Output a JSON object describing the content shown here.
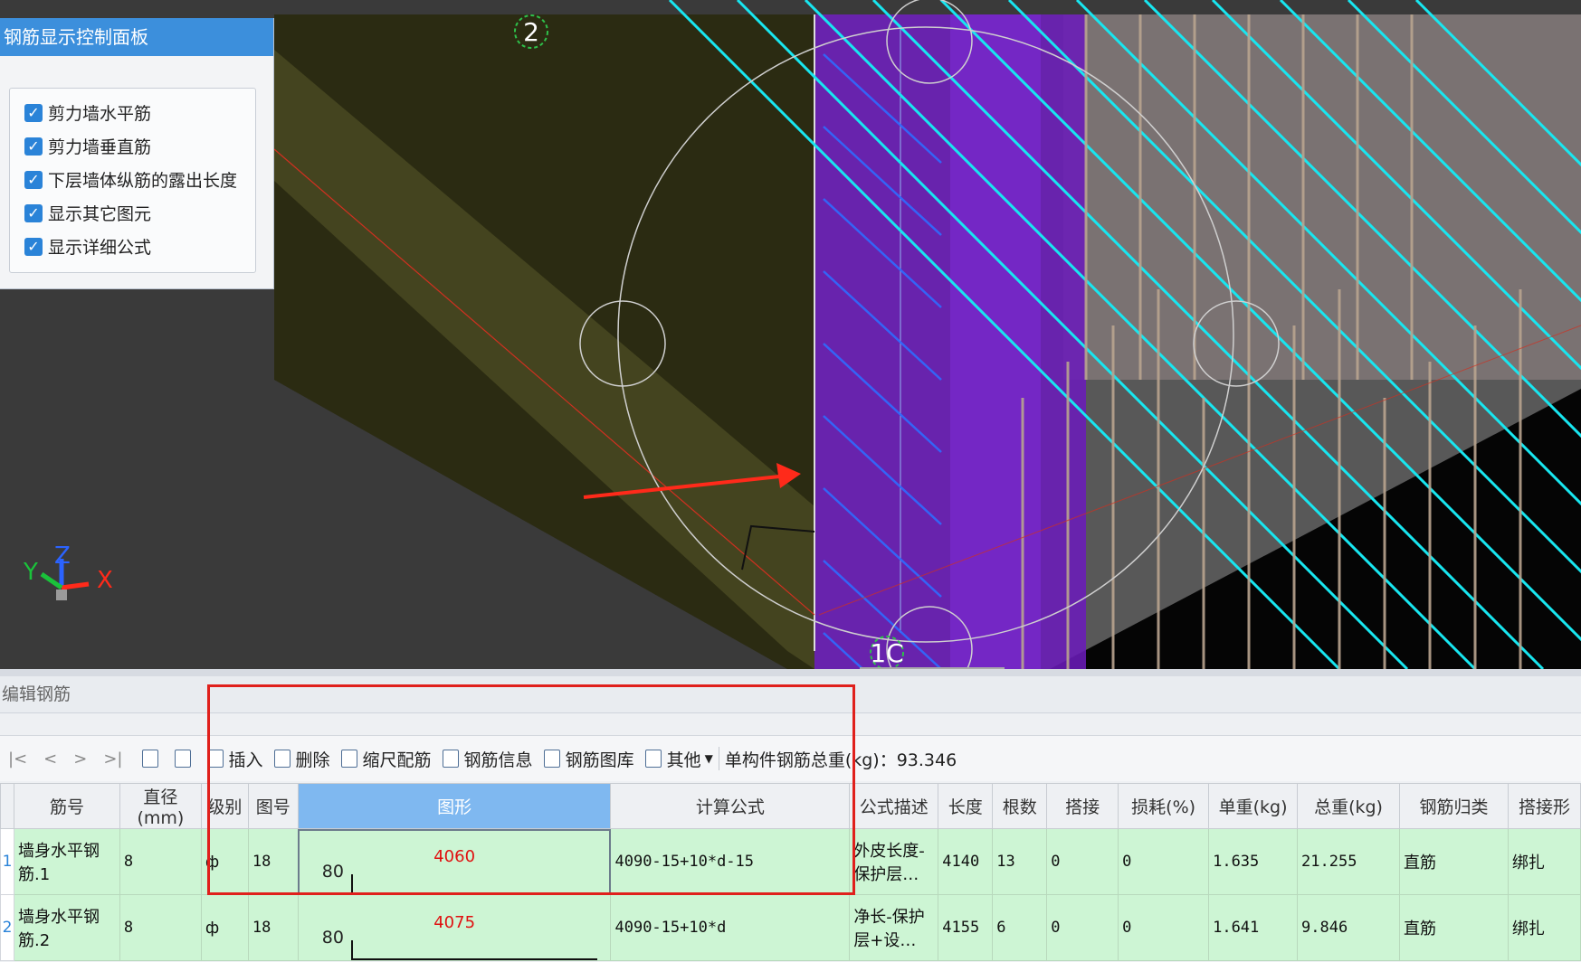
{
  "viewport": {
    "grid_label_top": "2",
    "grid_label_bottom": "1C",
    "axes": {
      "x": "X",
      "y": "Y",
      "z": "Z"
    }
  },
  "control_panel": {
    "title": "钢筋显示控制面板",
    "options": [
      {
        "label": "剪力墙水平筋",
        "checked": true
      },
      {
        "label": "剪力墙垂直筋",
        "checked": true
      },
      {
        "label": "下层墙体纵筋的露出长度",
        "checked": true
      },
      {
        "label": "显示其它图元",
        "checked": true
      },
      {
        "label": "显示详细公式",
        "checked": true
      }
    ]
  },
  "editor": {
    "title": "编辑钢筋",
    "nav": [
      "|<",
      "<",
      ">",
      ">|"
    ],
    "toolbar": {
      "insert": "插入",
      "delete": "删除",
      "scale": "缩尺配筋",
      "info": "钢筋信息",
      "library": "钢筋图库",
      "other": "其他",
      "total_weight": "单构件钢筋总重(kg)：93.346"
    },
    "columns": [
      "筋号",
      "直径(mm)",
      "级别",
      "图号",
      "图形",
      "计算公式",
      "公式描述",
      "长度",
      "根数",
      "搭接",
      "损耗(%)",
      "单重(kg)",
      "总重(kg)",
      "钢筋归类",
      "搭接形"
    ],
    "rows": [
      {
        "index": "1",
        "name": "墙身水平钢筋.1",
        "diameter": "8",
        "grade": "ф",
        "fig": "18",
        "shape_left": "80",
        "shape_value": "4060",
        "formula": "4090-15+10*d-15",
        "desc": "外皮长度-保护层…",
        "length": "4140",
        "count": "13",
        "lap": "0",
        "loss": "0",
        "unit_weight": "1.635",
        "total_weight": "21.255",
        "category": "直筋",
        "lap_type": "绑扎"
      },
      {
        "index": "2",
        "name": "墙身水平钢筋.2",
        "diameter": "8",
        "grade": "ф",
        "fig": "18",
        "shape_left": "80",
        "shape_value": "4075",
        "formula": "4090-15+10*d",
        "desc": "净长-保护层+设…",
        "length": "4155",
        "count": "6",
        "lap": "0",
        "loss": "0",
        "unit_weight": "1.641",
        "total_weight": "9.846",
        "category": "直筋",
        "lap_type": "绑扎"
      }
    ]
  },
  "colors": {
    "accent": "#3c8fdc",
    "row_bg": "#cdf5d4",
    "highlight": "#e0201c",
    "purple": "#6a1bb8",
    "cyan": "#18e6f0"
  }
}
